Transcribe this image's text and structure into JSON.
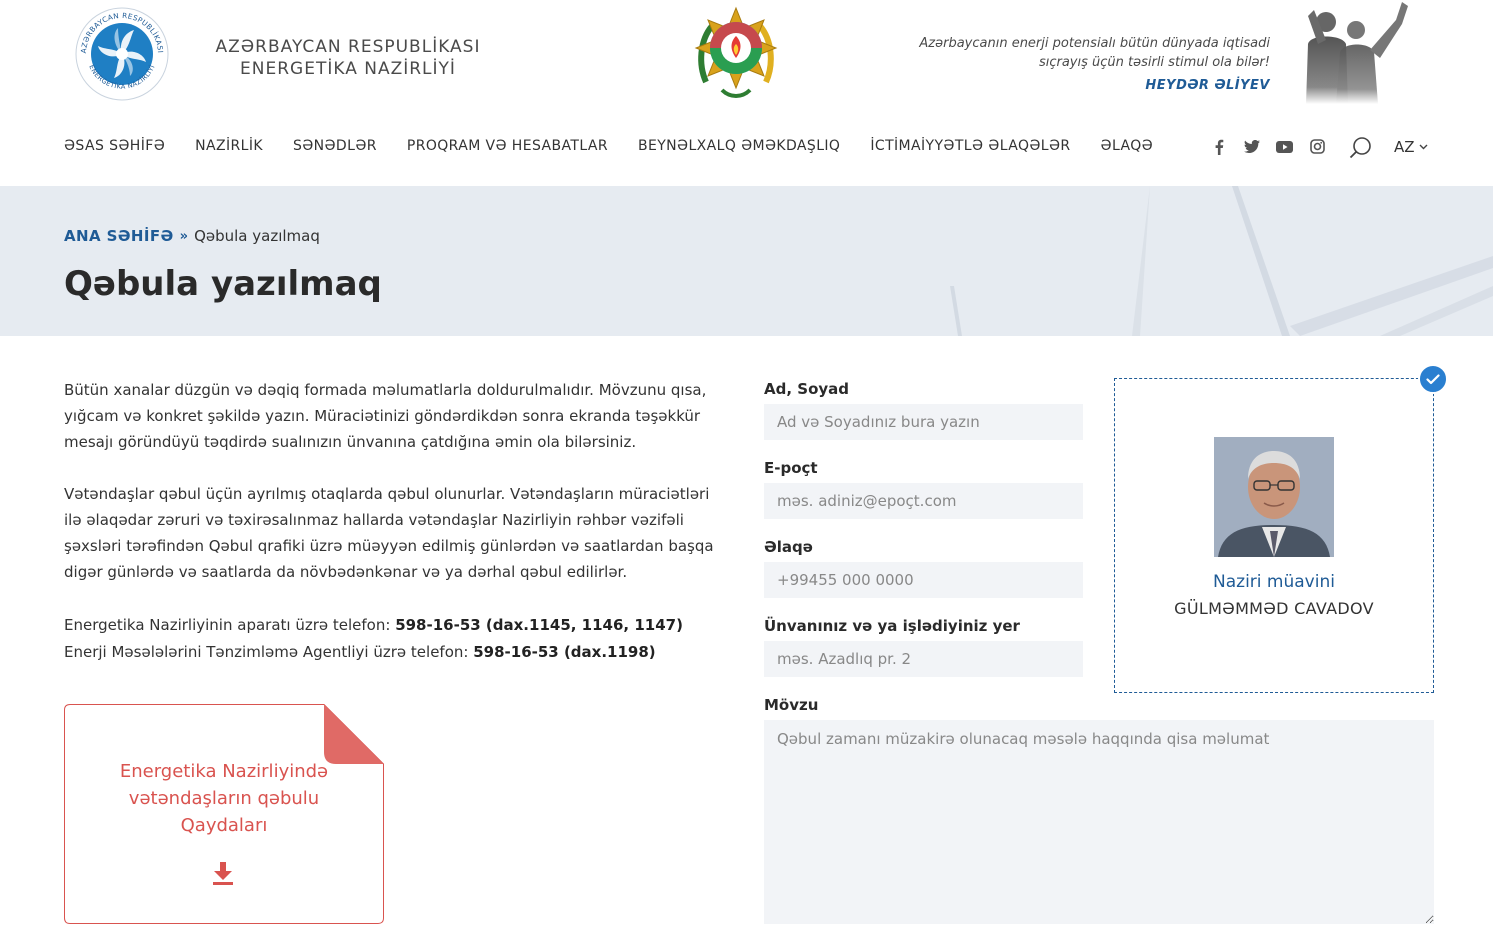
{
  "header": {
    "ministry_line1": "AZƏRBAYCAN RESPUBLİKASI",
    "ministry_line2": "ENERGETİKA NAZİRLİYİ",
    "logo_ring_text_top": "AZƏRBAYCAN RESPUBLİKASI",
    "logo_ring_text_bottom": "ENERGETİKA NAZİRLİYİ",
    "quote_line1": "Azərbaycanın enerji potensialı bütün dünyada iqtisadi",
    "quote_line2": "sıçrayış üçün təsirli stimul ola bilər!",
    "quote_author": "HEYDƏR ƏLİYEV"
  },
  "nav": {
    "items": [
      {
        "label": "ƏSAS SƏHİFƏ"
      },
      {
        "label": "NAZİRLİK"
      },
      {
        "label": "SƏNƏDLƏR"
      },
      {
        "label": "PROQRAM VƏ HESABATLAR"
      },
      {
        "label": "BEYNƏLXALQ ƏMƏKDAŞLIQ"
      },
      {
        "label": "İCTİMAİYYƏTLƏ ƏLAQƏLƏR"
      },
      {
        "label": "ƏLAQƏ"
      }
    ],
    "socials": [
      "facebook-icon",
      "twitter-icon",
      "youtube-icon",
      "instagram-icon"
    ],
    "language": "AZ"
  },
  "banner": {
    "breadcrumb_home": "ANA SƏHİFƏ",
    "breadcrumb_sep": "»",
    "breadcrumb_current": "Qəbula yazılmaq",
    "title": "Qəbula yazılmaq"
  },
  "content": {
    "para1": "Bütün xanalar düzgün və dəqiq formada məlumatlarla doldurulmalıdır. Mövzunu qısa, yığcam və konkret şəkildə yazın. Müraciətinizi göndərdikdən sonra ekranda təşəkkür mesajı göründüyü təqdirdə sualınızın ünvanına çatdığına əmin ola bilərsiniz.",
    "para2": "Vətəndaşlar qəbul üçün ayrılmış otaqlarda qəbul olunurlar. Vətəndaşların müraciətləri ilə əlaqədar zəruri və təxirəsalınmaz hallarda vətəndaşlar Nazirliyin rəhbər vəzifəli şəxsləri tərəfindən Qəbul qrafiki üzrə müəyyən edilmiş günlərdən və saatlardan başqa digər günlərdə və saatlarda da növbədənkənar və ya dərhal qəbul edilirlər.",
    "phone1_label": "Energetika Nazirliyinin aparatı üzrə telefon:",
    "phone1_value": "598-16-53 (dax.1145, 1146, 1147)",
    "phone2_label": "Enerji Məsələlərini Tənzimləmə Agentliyi üzrə telefon:",
    "phone2_value": "598-16-53 (dax.1198)",
    "doc_line1": "Energetika Nazirliyində",
    "doc_line2": "vətəndaşların qəbulu",
    "doc_line3": "Qaydaları"
  },
  "form": {
    "name_label": "Ad, Soyad",
    "name_placeholder": "Ad və Soyadınız bura yazın",
    "email_label": "E-poçt",
    "email_placeholder": "məs. adiniz@epoçt.com",
    "phone_label": "Əlaqə",
    "phone_placeholder": "+99455 000 0000",
    "address_label": "Ünvanınız və ya işlədiyiniz yer",
    "address_placeholder": "məs. Azadlıq pr. 2",
    "subject_label": "Mövzu",
    "subject_placeholder": "Qəbul zamanı müzakirə olunacaq məsələ haqqında qisa məlumat"
  },
  "official": {
    "role": "Naziri müavini",
    "name": "GÜLMƏMMƏD CAVADOV",
    "selected": true
  },
  "colors": {
    "brand_blue": "#1f5b96",
    "accent_red": "#d9534f",
    "banner_bg": "#e6ebf1",
    "input_bg": "#f2f4f7"
  }
}
